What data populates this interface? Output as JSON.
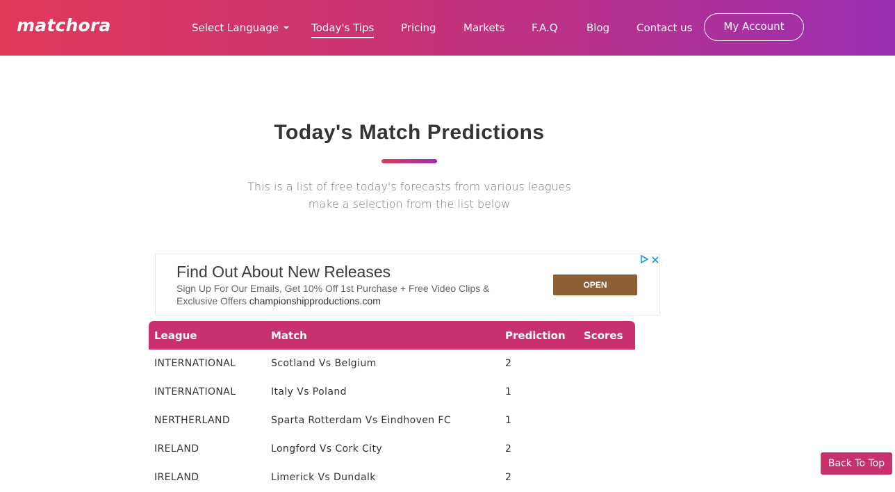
{
  "header": {
    "logo": "matchora",
    "nav": {
      "language": "Select Language",
      "tips": "Today's Tips",
      "pricing": "Pricing",
      "markets": "Markets",
      "faq": "F.A.Q",
      "blog": "Blog",
      "contact": "Contact us"
    },
    "account_label": "My Account"
  },
  "main": {
    "title": "Today's Match Predictions",
    "subtitle_line1": "This is a list of free today's forecasts from various leagues",
    "subtitle_line2": "make a selection from the list below"
  },
  "ad": {
    "headline": "Find Out About New Releases",
    "body": "Sign Up For Our Emails, Get 10% Off 1st Purchase + Free Video Clips & Exclusive Offers",
    "domain": "championshipproductions.com",
    "cta": "OPEN",
    "choices_icon": "adchoices-triangle-icon",
    "close_icon": "close-icon"
  },
  "table": {
    "headers": [
      "League",
      "Match",
      "Prediction",
      "Scores"
    ],
    "rows": [
      {
        "league": "INTERNATIONAL",
        "match": "Scotland Vs Belgium",
        "prediction": "2",
        "scores": ""
      },
      {
        "league": "INTERNATIONAL",
        "match": "Italy Vs Poland",
        "prediction": "1",
        "scores": ""
      },
      {
        "league": "NERTHERLAND",
        "match": "Sparta Rotterdam Vs Eindhoven FC",
        "prediction": "1",
        "scores": ""
      },
      {
        "league": "IRELAND",
        "match": "Longford Vs Cork City",
        "prediction": "2",
        "scores": ""
      },
      {
        "league": "IRELAND",
        "match": "Limerick Vs Dundalk",
        "prediction": "2",
        "scores": ""
      }
    ]
  },
  "back_to_top": "Back To Top",
  "colors": {
    "gradient_start": "#e0395a",
    "gradient_end": "#9b30b3",
    "accent": "#c8306f",
    "ad_button": "#8b5e34"
  }
}
